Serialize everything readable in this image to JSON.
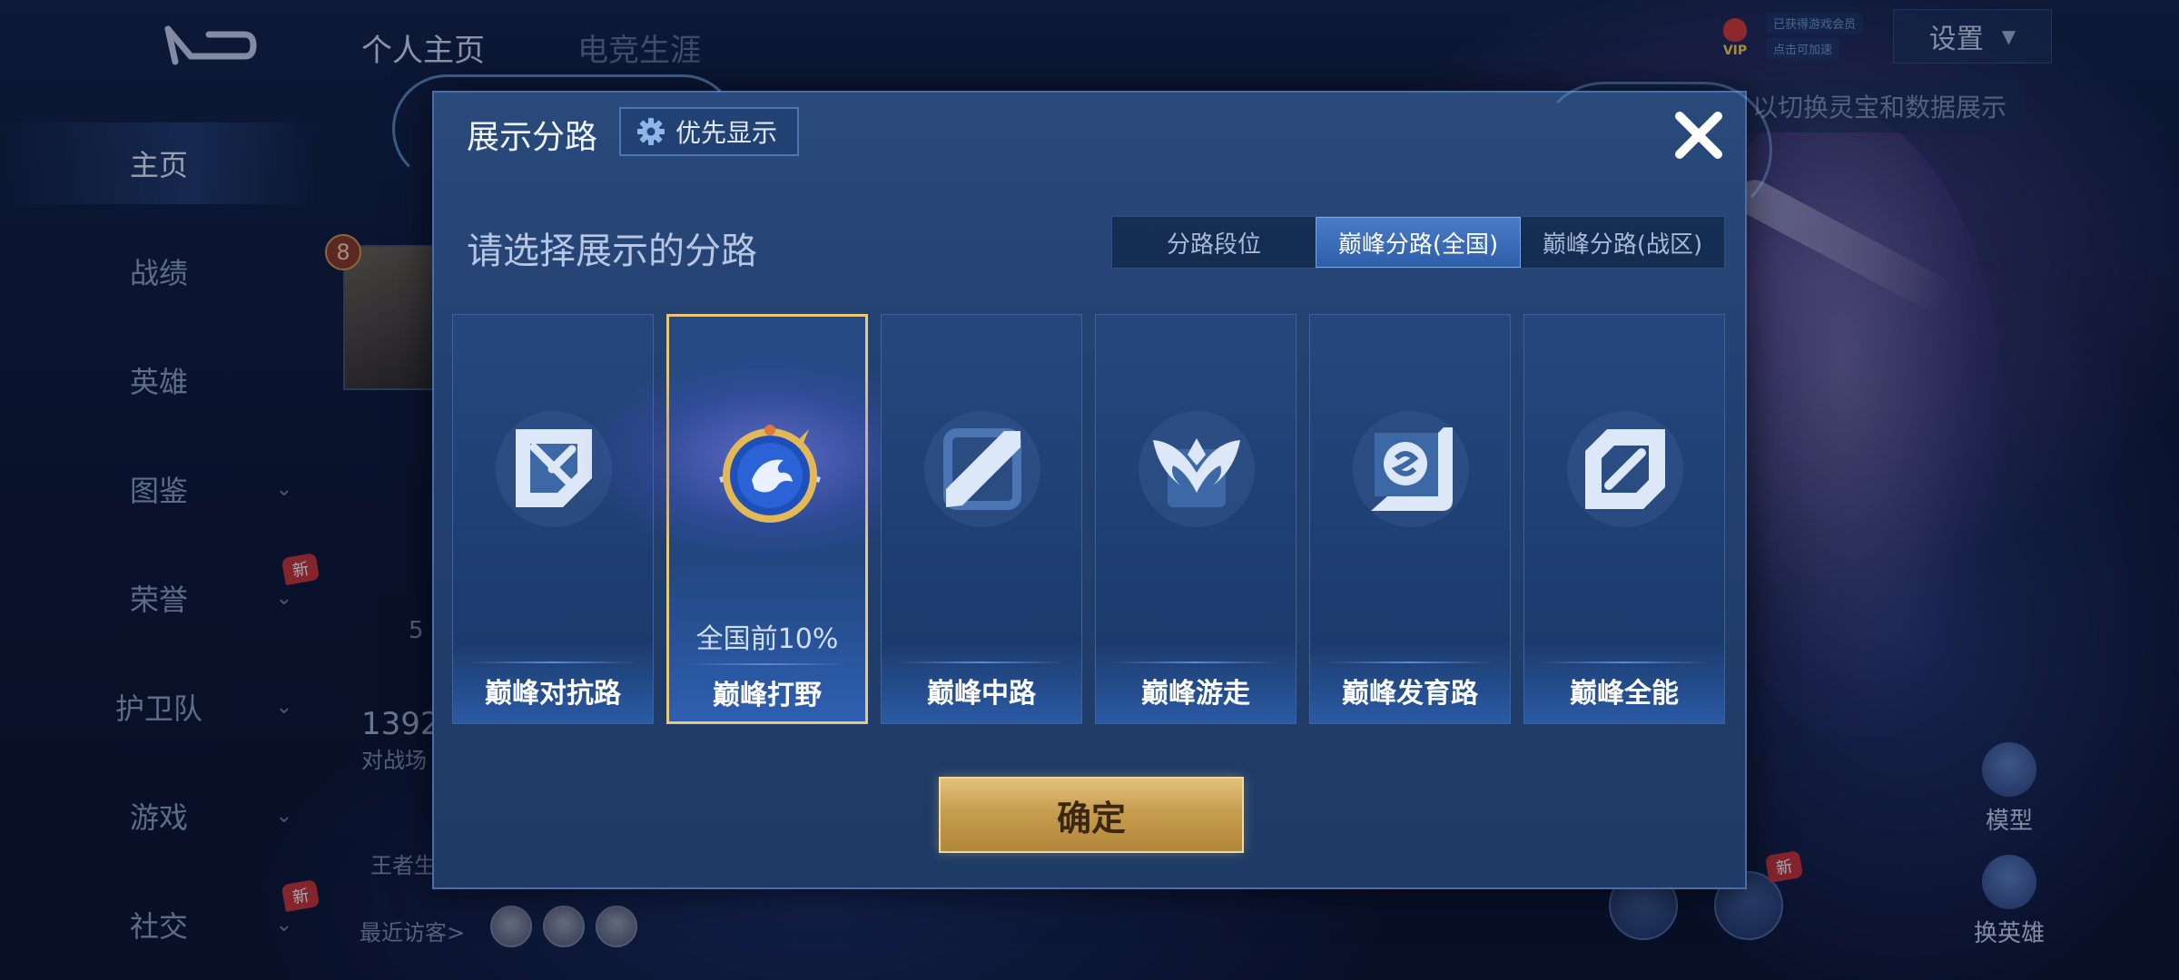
{
  "top_tabs": [
    "个人主页",
    "电竞生涯"
  ],
  "sidebar": {
    "items": [
      {
        "label": "主页",
        "active": true
      },
      {
        "label": "战绩"
      },
      {
        "label": "英雄"
      },
      {
        "label": "图鉴"
      },
      {
        "label": "荣誉",
        "badge": "新"
      },
      {
        "label": "护卫队"
      },
      {
        "label": "游戏"
      },
      {
        "label": "社交",
        "badge": "新"
      }
    ]
  },
  "profile": {
    "level": "8",
    "stat_number": "1392",
    "stat_label": "对战场",
    "kda_text": "5",
    "server_label": "王者生",
    "visitors_label": "最近访客>"
  },
  "top_right": {
    "vip_label": "VIP",
    "vip_note_1": "已获得游戏会员",
    "vip_note_2": "点击可加速",
    "settings_label": "设置",
    "hint_text": "以切换灵宝和数据展示"
  },
  "bottom_right": {
    "model_label": "模型",
    "change_hero_label": "换英雄",
    "new_badge": "新"
  },
  "modal": {
    "title": "展示分路",
    "priority_label": "优先显示",
    "subtitle": "请选择展示的分路",
    "segments": [
      {
        "label": "分路段位"
      },
      {
        "label": "巅峰分路(全国)",
        "active": true
      },
      {
        "label": "巅峰分路(战区)"
      }
    ],
    "cards": [
      {
        "label": "巅峰对抗路",
        "icon": "sword-cross-icon"
      },
      {
        "label": "巅峰打野",
        "icon": "dragon-emblem-icon",
        "selected": true,
        "rank": "全国前10%"
      },
      {
        "label": "巅峰中路",
        "icon": "diagonal-slash-icon"
      },
      {
        "label": "巅峰游走",
        "icon": "wings-icon"
      },
      {
        "label": "巅峰发育路",
        "icon": "s-shield-icon"
      },
      {
        "label": "巅峰全能",
        "icon": "all-round-icon"
      }
    ],
    "confirm_label": "确定"
  },
  "colors": {
    "selected_border": "#e9c87a",
    "active_segment": "#3a6cb8",
    "confirm_gold": "#c79d4e"
  }
}
